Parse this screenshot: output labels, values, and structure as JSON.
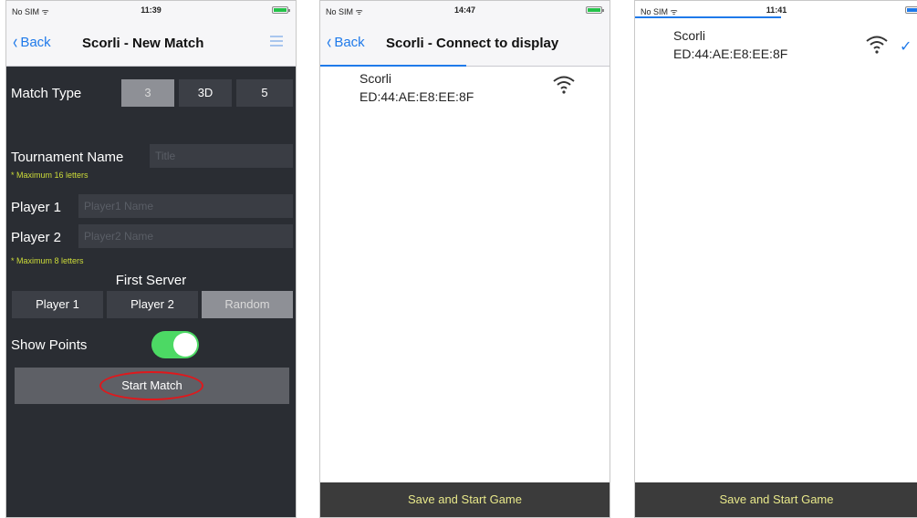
{
  "new_match": {
    "status": {
      "carrier": "No SIM ᯤ",
      "time": "11:39"
    },
    "nav": {
      "back": "Back",
      "title": "Scorli - New Match"
    },
    "match_type": {
      "label": "Match Type",
      "options": [
        "3",
        "3D",
        "5"
      ],
      "selected": "3"
    },
    "tournament": {
      "label": "Tournament Name",
      "placeholder": "Title",
      "note": "* Maximum 16 letters"
    },
    "player1": {
      "label": "Player 1",
      "placeholder": "Player1 Name"
    },
    "player2": {
      "label": "Player 2",
      "placeholder": "Player2 Name"
    },
    "players_note": "* Maximum 8 letters",
    "first_server": {
      "label": "First Server",
      "options": [
        "Player 1",
        "Player 2",
        "Random"
      ],
      "selected": "Random"
    },
    "show_points": {
      "label": "Show Points",
      "on": true
    },
    "start_button": "Start Match",
    "colors": {
      "background": "#2a2d33",
      "toggle_on": "#4cd964",
      "note": "#cddc39",
      "highlight_ring": "#e0181c"
    }
  },
  "connect": {
    "status": {
      "carrier": "No SIM ᯤ",
      "time": "14:47"
    },
    "nav": {
      "back": "Back",
      "title": "Scorli - Connect to display"
    },
    "device": {
      "name": "Scorli",
      "address": "ED:44:AE:E8:EE:8F",
      "icon": "wifi-icon"
    },
    "bottom_button": "Save and Start Game"
  },
  "connected": {
    "status": {
      "carrier": "No SIM ᯤ",
      "time": "11:41"
    },
    "device": {
      "name": "Scorli",
      "address": "ED:44:AE:E8:EE:8F",
      "icon": "wifi-icon",
      "checked": "✓"
    },
    "bottom_button": "Save and Start Game"
  }
}
